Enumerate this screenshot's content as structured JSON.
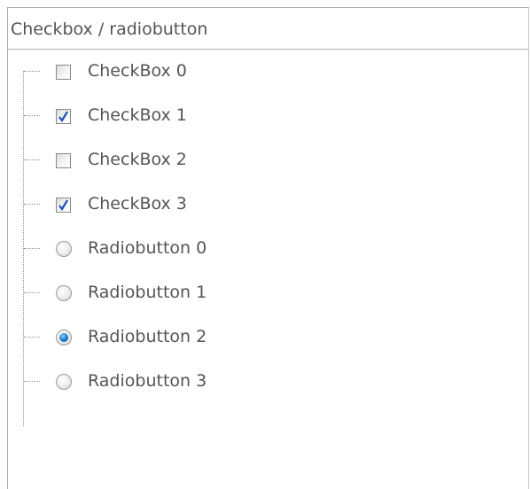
{
  "header": {
    "title": "Checkbox / radiobutton"
  },
  "items": [
    {
      "type": "checkbox",
      "label": "CheckBox 0",
      "checked": false
    },
    {
      "type": "checkbox",
      "label": "CheckBox 1",
      "checked": true
    },
    {
      "type": "checkbox",
      "label": "CheckBox 2",
      "checked": false
    },
    {
      "type": "checkbox",
      "label": "CheckBox 3",
      "checked": true
    },
    {
      "type": "radio",
      "label": "Radiobutton 0",
      "checked": false
    },
    {
      "type": "radio",
      "label": "Radiobutton 1",
      "checked": false
    },
    {
      "type": "radio",
      "label": "Radiobutton 2",
      "checked": true
    },
    {
      "type": "radio",
      "label": "Radiobutton 3",
      "checked": false
    }
  ],
  "colors": {
    "text": "#555555",
    "check": "#1f4fb5",
    "radio_selected": "#1b7fd1"
  }
}
